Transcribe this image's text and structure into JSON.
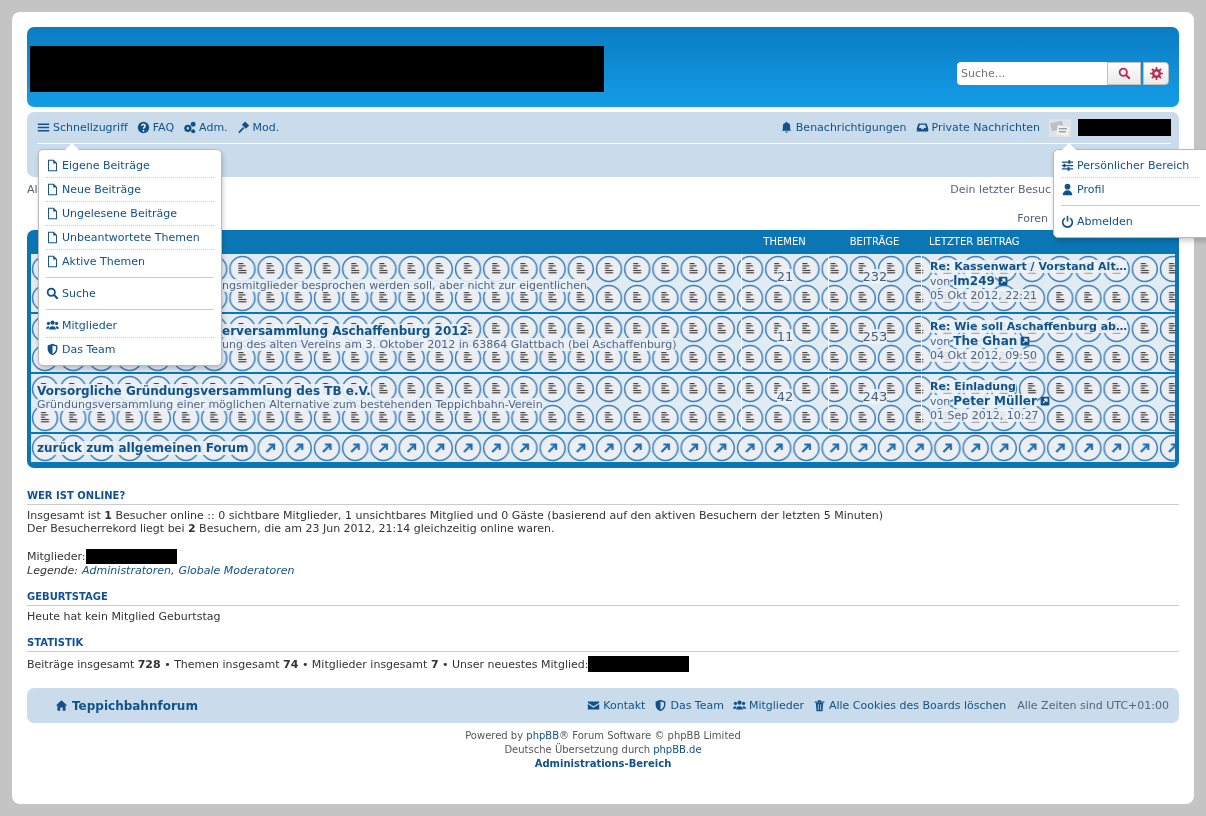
{
  "header": {
    "search": {
      "placeholder": "Suche..."
    }
  },
  "navbar": {
    "left": [
      {
        "label": "Schnellzugriff"
      },
      {
        "label": "FAQ"
      },
      {
        "label": "Adm."
      },
      {
        "label": "Mod."
      }
    ],
    "right": [
      {
        "label": "Benachrichtigungen"
      },
      {
        "label": "Private Nachrichten"
      }
    ]
  },
  "quick_menu": {
    "sections": [
      [
        {
          "label": "Eigene Beiträge"
        },
        {
          "label": "Neue Beiträge"
        },
        {
          "label": "Ungelesene Beiträge"
        },
        {
          "label": "Unbeantwortete Themen"
        },
        {
          "label": "Aktive Themen"
        }
      ],
      [
        {
          "label": "Suche"
        }
      ],
      [
        {
          "label": "Mitglieder"
        },
        {
          "label": "Das Team"
        }
      ]
    ]
  },
  "profile_menu": {
    "sections": [
      [
        {
          "label": "Persönlicher Bereich"
        },
        {
          "label": "Profil"
        }
      ],
      [
        {
          "label": "Abmelden"
        }
      ]
    ]
  },
  "info_bar": {
    "left": "Al",
    "right": "Dein letzter Besuc",
    "forums_link": "Foren"
  },
  "forum_table": {
    "columns": [
      "THEMEN",
      "BEITRÄGE",
      "LETZTER BEITRAG"
    ],
    "rows": [
      {
        "kind": "forum",
        "partly_hidden": true,
        "description": "ngsmitglieder besprochen werden soll, aber nicht zur eigentlichen",
        "topics": "21",
        "posts": "232",
        "last_post": {
          "title": "Re: Kassenwart / Vorstand Alt…",
          "by": "von",
          "author": "lm249",
          "date": "05 Okt 2012, 22:21"
        }
      },
      {
        "kind": "forum",
        "partly_hidden": true,
        "title": "erversammlung Aschaffenburg 2012",
        "description": "ung des alten Vereins am 3. Oktober 2012 in 63864 Glattbach (bei Aschaffenburg)",
        "topics": "11",
        "posts": "253",
        "last_post": {
          "title": "Re: Wie soll Aschaffenburg ab…",
          "by": "von",
          "author": "The Ghan",
          "date": "04 Okt 2012, 09:50"
        }
      },
      {
        "kind": "forum",
        "partly_hidden": false,
        "title": "Vorsorgliche Gründungsversammlung des TB e.V.",
        "description": "Gründungsversammlung einer möglichen Alternative zum bestehenden Teppichbahn-Verein",
        "topics": "42",
        "posts": "243",
        "last_post": {
          "title": "Re: Einladung",
          "by": "von",
          "author": "Peter Müller",
          "date": "01 Sep 2012, 10:27"
        }
      },
      {
        "kind": "link",
        "partly_hidden": false,
        "title": "zurück zum allgemeinen Forum"
      }
    ]
  },
  "online": {
    "heading": "WER IST ONLINE?",
    "lines": [
      "Insgesamt ist **1** Besucher online :: 0 sichtbare Mitglieder, 1 unsichtbares Mitglied und 0 Gäste (basierend auf den aktiven Besuchern der letzten 5 Minuten)",
      "Der Besucherrekord liegt bei **2** Besuchern, die am 23 Jun 2012, 21:14 gleichzeitig online waren."
    ],
    "members_label": "Mitglieder:",
    "legend": {
      "label": "Legende:",
      "groups": [
        "Administratoren,",
        "Globale Moderatoren"
      ]
    }
  },
  "birthdays": {
    "heading": "GEBURTSTAGE",
    "text": "Heute hat kein Mitglied Geburtstag"
  },
  "statistics": {
    "heading": "STATISTIK",
    "text": "Beiträge insgesamt **728** • Themen insgesamt **74** • Mitglieder insgesamt **7** • Unser neuestes Mitglied:"
  },
  "footer": {
    "home": "Teppichbahnforum",
    "links": [
      {
        "label": "Kontakt"
      },
      {
        "label": "Das Team"
      },
      {
        "label": "Mitglieder"
      },
      {
        "label": "Alle Cookies des Boards löschen"
      }
    ],
    "timezone": "Alle Zeiten sind UTC+01:00"
  },
  "credits": {
    "powered": {
      "before": "Powered by",
      "link": "phpBB",
      "after": "® Forum Software © phpBB Limited"
    },
    "translation": {
      "before": "Deutsche Übersetzung durch",
      "link": "phpBB.de"
    },
    "admin": "Administrations-Bereich"
  }
}
